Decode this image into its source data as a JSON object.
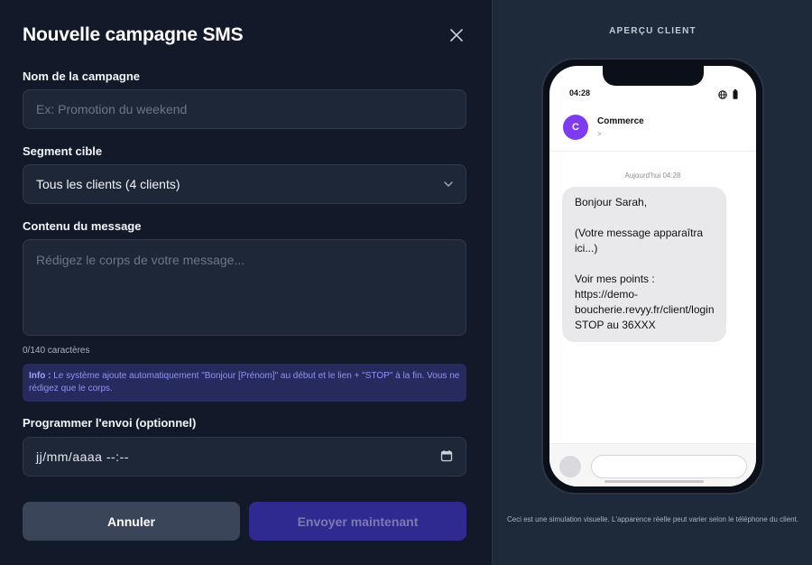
{
  "modal": {
    "title": "Nouvelle campagne SMS"
  },
  "form": {
    "name_label": "Nom de la campagne",
    "name_placeholder": "Ex: Promotion du weekend",
    "segment_label": "Segment cible",
    "segment_value": "Tous les clients (4 clients)",
    "content_label": "Contenu du message",
    "content_placeholder": "Rédigez le corps de votre message...",
    "char_count": "0/140 caractères",
    "info_prefix": "Info :",
    "info_text": " Le système ajoute automatiquement \"Bonjour [Prénom]\" au début et le lien + \"STOP\" à la fin. Vous ne rédigez que le corps.",
    "schedule_label": "Programmer l'envoi (optionnel)",
    "schedule_value": "jj/mm/aaaa --:--"
  },
  "buttons": {
    "cancel": "Annuler",
    "send": "Envoyer maintenant"
  },
  "preview": {
    "title": "APERÇU CLIENT",
    "status_time": "04:28",
    "contact_initial": "C",
    "contact_name": "Commerce",
    "contact_sub": ">",
    "timestamp": "Aujourd'hui 04:28",
    "message": "Bonjour Sarah,\n\n(Votre message apparaîtra ici...)\n\nVoir mes points : https://demo-boucherie.revyy.fr/client/login\nSTOP au 36XXX",
    "disclaimer": "Ceci est une simulation visuelle. L'apparence réelle peut varier selon le téléphone du client."
  },
  "colors": {
    "accent": "#2f2a8f",
    "avatar": "#7d3cf2",
    "info_bg": "#272a5c"
  },
  "icons": {
    "close": "close-icon",
    "chevron": "chevron-down-icon",
    "calendar": "calendar-icon",
    "globe": "globe-icon",
    "battery": "battery-icon"
  }
}
